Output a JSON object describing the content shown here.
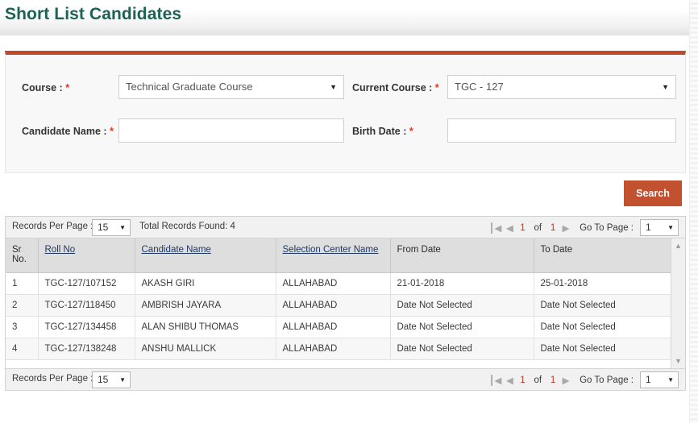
{
  "header": {
    "title": "Short List Candidates"
  },
  "form": {
    "course": {
      "label": "Course : ",
      "required": "*",
      "value": "Technical Graduate Course"
    },
    "current_course": {
      "label": "Current Course : ",
      "required": "*",
      "value": "TGC - 127"
    },
    "candidate_name": {
      "label": "Candidate Name : ",
      "required": "*",
      "value": "",
      "placeholder": ""
    },
    "birth_date": {
      "label": "Birth Date : ",
      "required": "*",
      "value": "",
      "placeholder": ""
    },
    "search_button": "Search"
  },
  "pager": {
    "records_per_page_label": "Records Per Page :",
    "records_per_page_value": "15",
    "total_records": "Total Records Found: 4",
    "current_page": "1",
    "total_pages": "1",
    "of_label": "of",
    "goto_label": "Go To Page :",
    "goto_value": "1",
    "icons": {
      "first": "first-page-icon",
      "prev": "previous-page-icon",
      "next": "next-page-icon",
      "dropdown": "chevron-down-icon"
    }
  },
  "table": {
    "columns": [
      {
        "label": "Sr No.",
        "sortable": false
      },
      {
        "label": "Roll No",
        "sortable": true
      },
      {
        "label": "Candidate Name",
        "sortable": true
      },
      {
        "label": "Selection Center Name",
        "sortable": true
      },
      {
        "label": "From Date",
        "sortable": false
      },
      {
        "label": "To Date",
        "sortable": false
      }
    ],
    "rows": [
      {
        "sr": "1",
        "roll_no": "TGC-127/107152",
        "candidate_name": "AKASH GIRI",
        "selection_center": "ALLAHABAD",
        "from_date": "21-01-2018",
        "to_date": "25-01-2018"
      },
      {
        "sr": "2",
        "roll_no": "TGC-127/118450",
        "candidate_name": "AMBRISH JAYARA",
        "selection_center": "ALLAHABAD",
        "from_date": "Date Not Selected",
        "to_date": "Date Not Selected"
      },
      {
        "sr": "3",
        "roll_no": "TGC-127/134458",
        "candidate_name": "ALAN SHIBU THOMAS",
        "selection_center": "ALLAHABAD",
        "from_date": "Date Not Selected",
        "to_date": "Date Not Selected"
      },
      {
        "sr": "4",
        "roll_no": "TGC-127/138248",
        "candidate_name": "ANSHU MALLICK",
        "selection_center": "ALLAHABAD",
        "from_date": "Date Not Selected",
        "to_date": "Date Not Selected"
      }
    ]
  },
  "colors": {
    "title": "#1d6254",
    "accent_orange": "#c1492a",
    "button": "#c1512f",
    "required_star": "#e8331c",
    "page_number": "#b03a2a",
    "header_link": "#1f3864"
  }
}
